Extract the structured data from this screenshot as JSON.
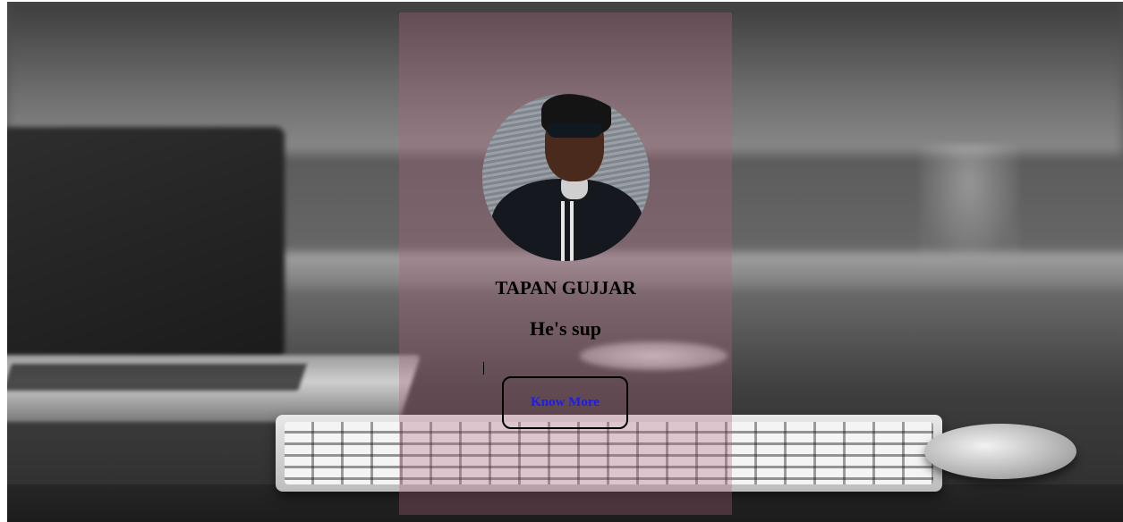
{
  "profile": {
    "name": "TAPAN GUJJAR",
    "tagline": "He's sup",
    "avatar_alt": "profile photo"
  },
  "actions": {
    "know_more_label": "Know More"
  },
  "colors": {
    "panel_tint": "#aa6478",
    "button_text": "#1a1aff",
    "button_border": "#000000"
  }
}
